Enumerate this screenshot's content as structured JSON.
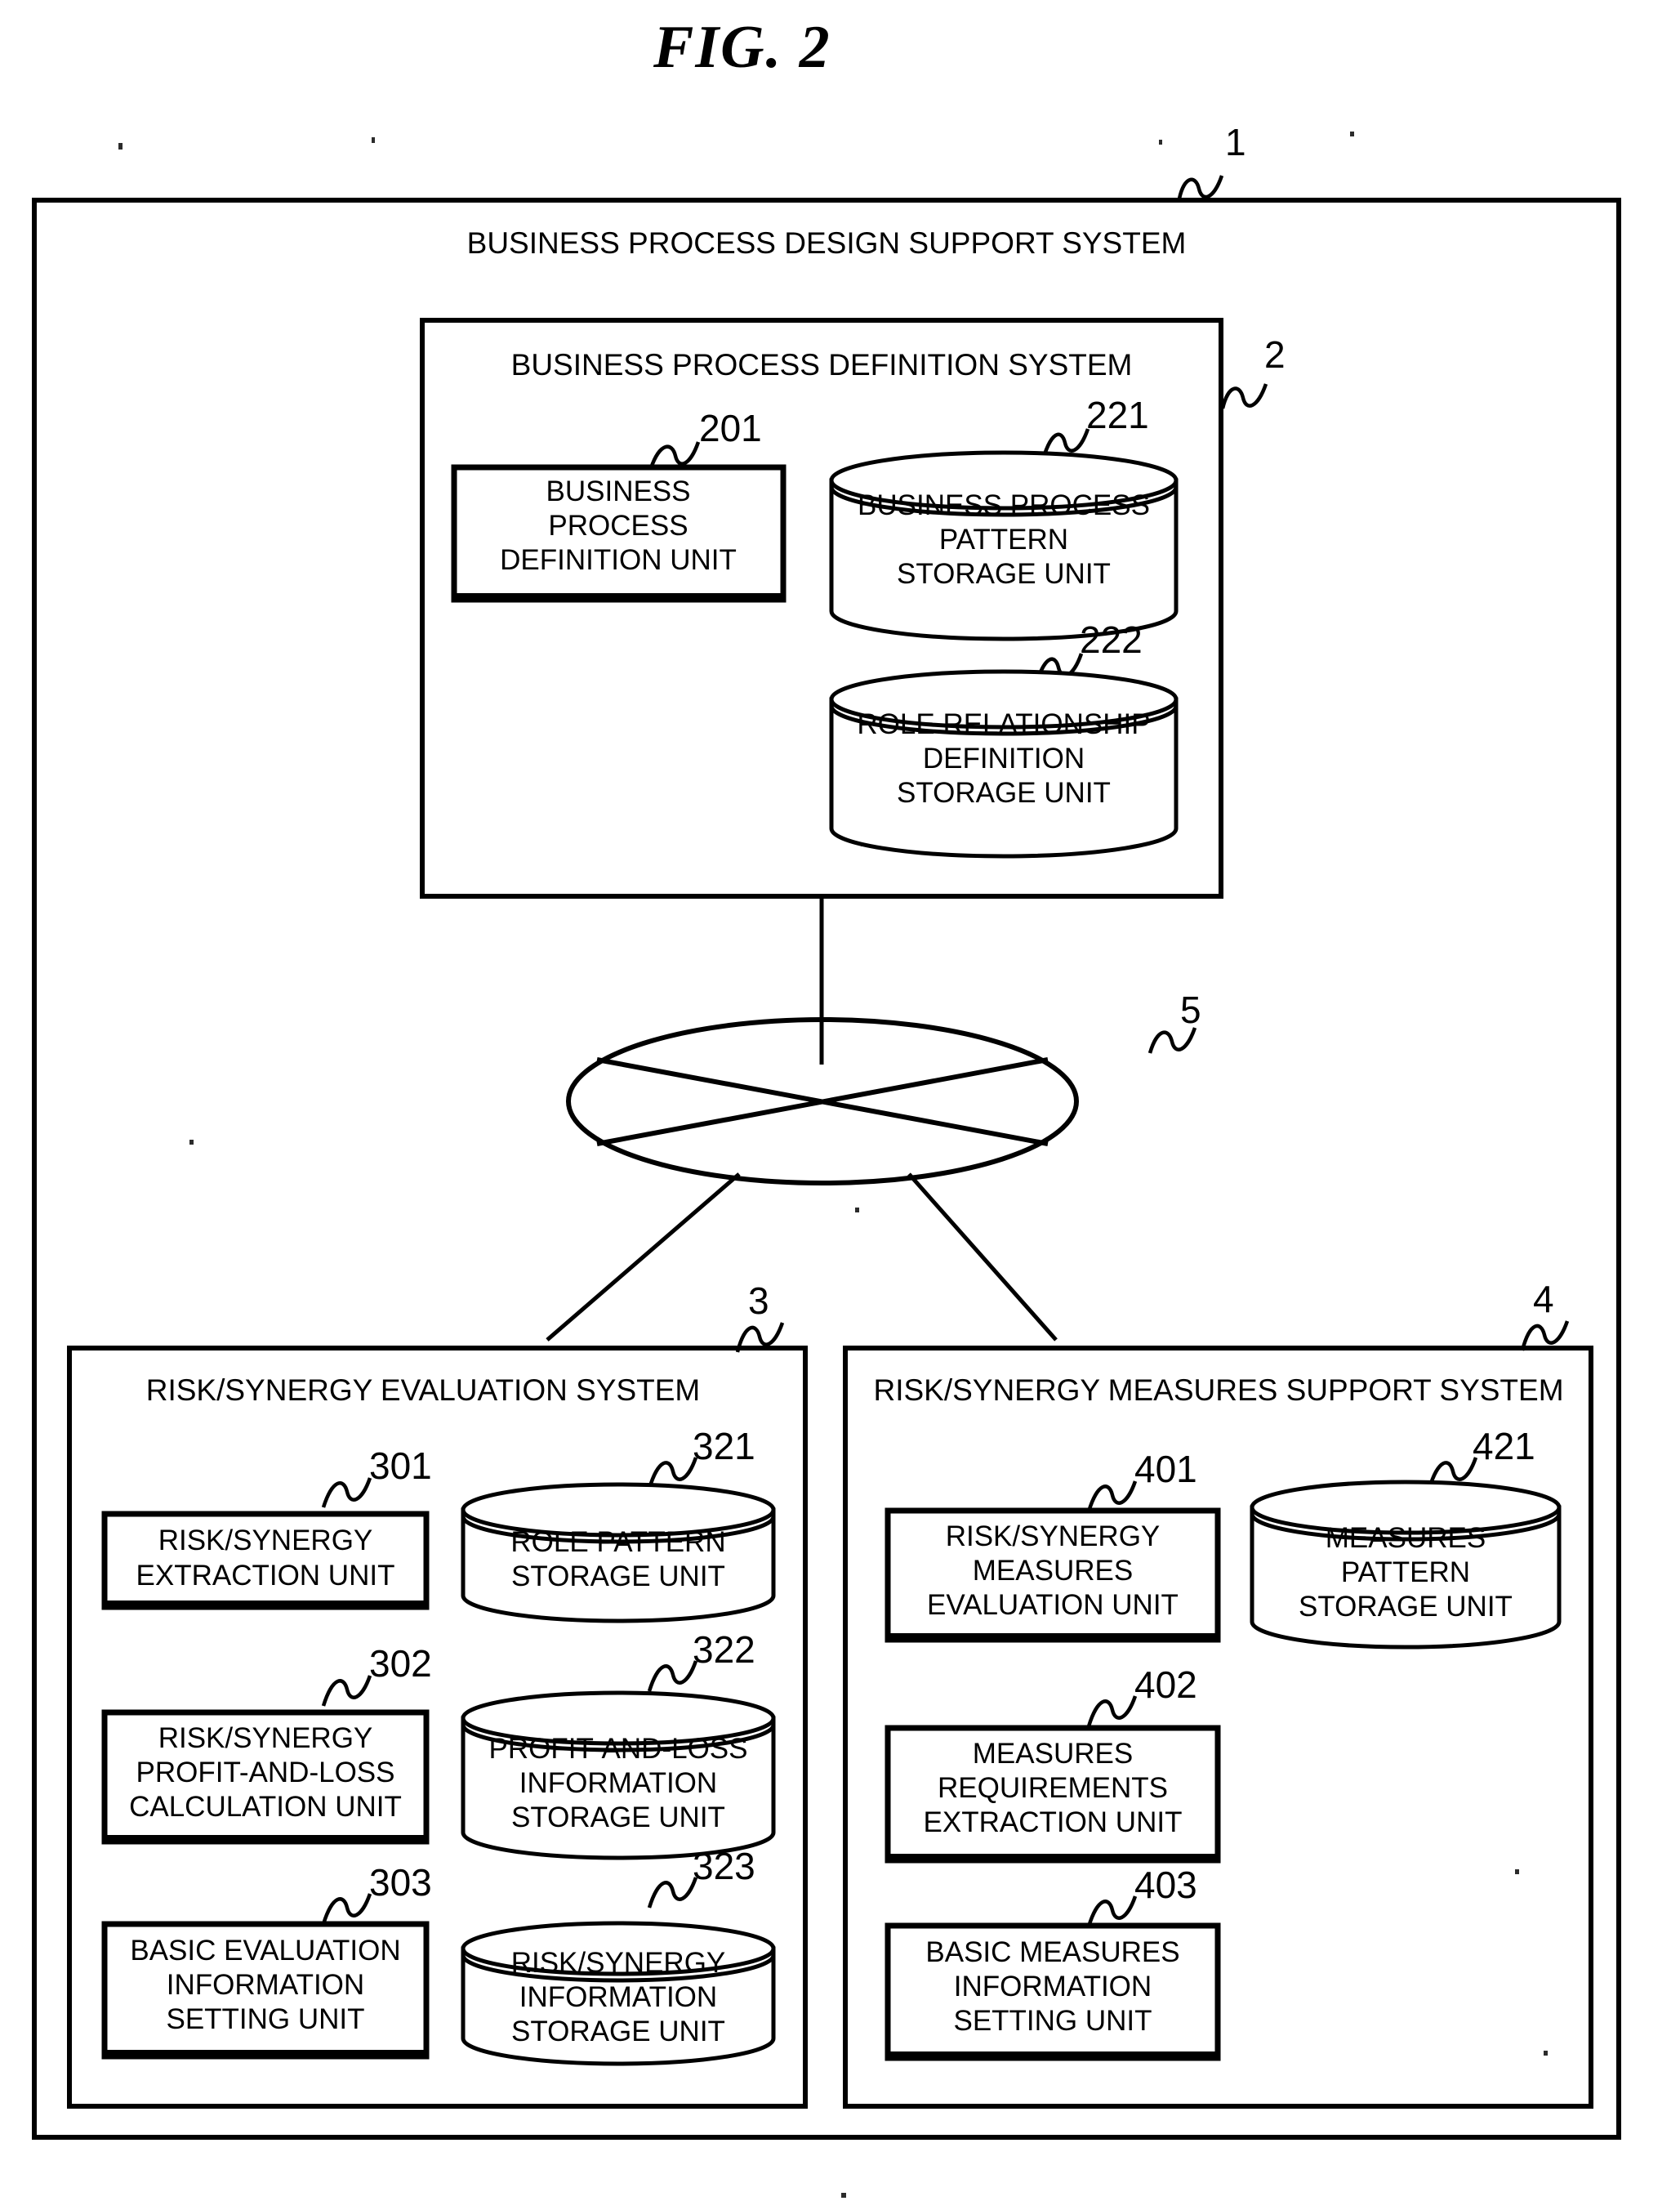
{
  "figure": {
    "title": "FIG.  2",
    "type": "patent-block-diagram"
  },
  "outer_system": {
    "ref": "1",
    "title": "BUSINESS PROCESS DESIGN SUPPORT SYSTEM"
  },
  "network": {
    "ref": "5",
    "icon": "network-cloud-ellipse"
  },
  "definition_system": {
    "ref": "2",
    "title": "BUSINESS PROCESS DEFINITION SYSTEM",
    "units": [
      {
        "ref": "201",
        "shape": "process-box",
        "lines": [
          "BUSINESS",
          "PROCESS",
          "DEFINITION UNIT"
        ]
      }
    ],
    "storages": [
      {
        "ref": "221",
        "shape": "database-cylinder",
        "lines": [
          "BUSINESS PROCESS",
          "PATTERN",
          "STORAGE UNIT"
        ]
      },
      {
        "ref": "222",
        "shape": "database-cylinder",
        "lines": [
          "ROLE RELATIONSHIP",
          "DEFINITION",
          "STORAGE UNIT"
        ]
      }
    ]
  },
  "evaluation_system": {
    "ref": "3",
    "title": "RISK/SYNERGY EVALUATION SYSTEM",
    "units": [
      {
        "ref": "301",
        "shape": "process-box",
        "lines": [
          "RISK/SYNERGY",
          "EXTRACTION UNIT"
        ]
      },
      {
        "ref": "302",
        "shape": "process-box",
        "lines": [
          "RISK/SYNERGY",
          "PROFIT-AND-LOSS",
          "CALCULATION UNIT"
        ]
      },
      {
        "ref": "303",
        "shape": "process-box",
        "lines": [
          "BASIC EVALUATION",
          "INFORMATION",
          "SETTING UNIT"
        ]
      }
    ],
    "storages": [
      {
        "ref": "321",
        "shape": "database-cylinder",
        "lines": [
          "ROLE PATTERN",
          "STORAGE UNIT"
        ]
      },
      {
        "ref": "322",
        "shape": "database-cylinder",
        "lines": [
          "PROFIT-AND-LOSS",
          "INFORMATION",
          "STORAGE UNIT"
        ]
      },
      {
        "ref": "323",
        "shape": "database-cylinder",
        "lines": [
          "RISK/SYNERGY",
          "INFORMATION",
          "STORAGE UNIT"
        ]
      }
    ]
  },
  "measures_system": {
    "ref": "4",
    "title": "RISK/SYNERGY MEASURES SUPPORT SYSTEM",
    "units": [
      {
        "ref": "401",
        "shape": "process-box",
        "lines": [
          "RISK/SYNERGY",
          "MEASURES",
          "EVALUATION UNIT"
        ]
      },
      {
        "ref": "402",
        "shape": "process-box",
        "lines": [
          "MEASURES",
          "REQUIREMENTS",
          "EXTRACTION UNIT"
        ]
      },
      {
        "ref": "403",
        "shape": "process-box",
        "lines": [
          "BASIC MEASURES",
          "INFORMATION",
          "SETTING UNIT"
        ]
      }
    ],
    "storages": [
      {
        "ref": "421",
        "shape": "database-cylinder",
        "lines": [
          "MEASURES",
          "PATTERN",
          "STORAGE UNIT"
        ]
      }
    ]
  },
  "colors": {
    "ink": "#000000",
    "paper": "#ffffff"
  }
}
